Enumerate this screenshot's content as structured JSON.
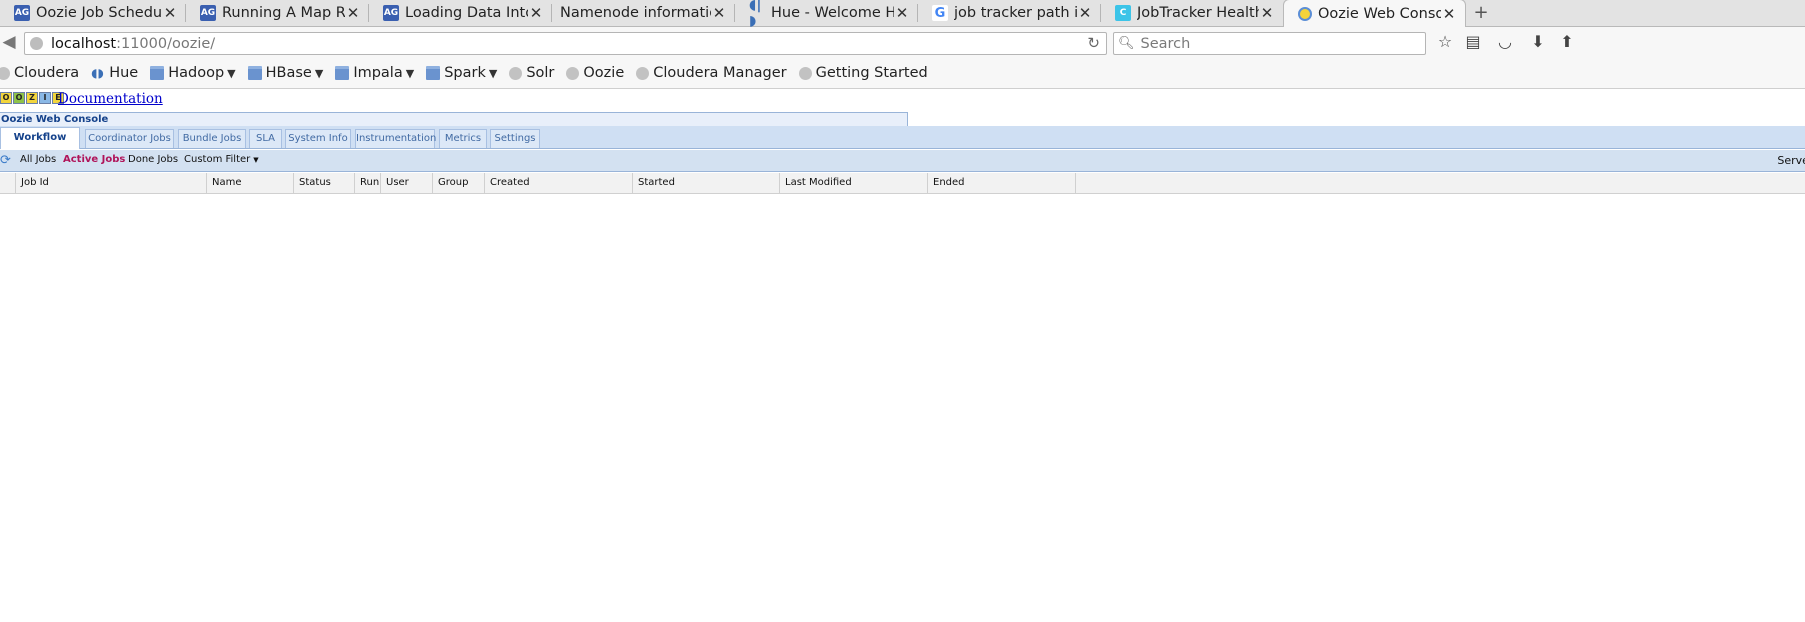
{
  "browser": {
    "tabs": [
      {
        "title": "Oozie Job Scheduling...",
        "icon": "ag-icon",
        "active": false
      },
      {
        "title": "Running A Map Redu...",
        "icon": "ag-icon",
        "active": false
      },
      {
        "title": "Loading Data Into HB...",
        "icon": "ag-icon",
        "active": false
      },
      {
        "title": "Namenode information",
        "icon": "none",
        "active": false
      },
      {
        "title": "Hue - Welcome Home",
        "icon": "hue-icon",
        "active": false
      },
      {
        "title": "job tracker path in cl...",
        "icon": "google-icon",
        "active": false
      },
      {
        "title": "JobTracker Health Tests",
        "icon": "cloudera-c-icon",
        "active": false
      },
      {
        "title": "Oozie Web Console",
        "icon": "oozie-icon",
        "active": true
      }
    ],
    "url_host": "localhost",
    "url_path": ":11000/oozie/",
    "search_placeholder": "Search",
    "bookmarks": [
      {
        "label": "Cloudera",
        "icon": "globe-icon",
        "dropdown": false
      },
      {
        "label": "Hue",
        "icon": "hue-icon",
        "dropdown": false
      },
      {
        "label": "Hadoop",
        "icon": "folder-icon",
        "dropdown": true
      },
      {
        "label": "HBase",
        "icon": "folder-icon",
        "dropdown": true
      },
      {
        "label": "Impala",
        "icon": "folder-icon",
        "dropdown": true
      },
      {
        "label": "Spark",
        "icon": "folder-icon",
        "dropdown": true
      },
      {
        "label": "Solr",
        "icon": "globe-icon",
        "dropdown": false
      },
      {
        "label": "Oozie",
        "icon": "globe-icon",
        "dropdown": false
      },
      {
        "label": "Cloudera Manager",
        "icon": "globe-icon",
        "dropdown": false
      },
      {
        "label": "Getting Started",
        "icon": "globe-icon",
        "dropdown": false
      }
    ]
  },
  "oozie": {
    "logo_letters": [
      "O",
      "O",
      "Z",
      "I",
      "E"
    ],
    "documentation_link": "Documentation",
    "console_title": "Oozie Web Console",
    "tabs": [
      "Workflow Jobs",
      "Coordinator Jobs",
      "Bundle Jobs",
      "SLA",
      "System Info",
      "Instrumentation",
      "Metrics",
      "Settings"
    ],
    "active_tab": "Workflow Jobs",
    "filters": [
      "All Jobs",
      "Active Jobs",
      "Done Jobs",
      "Custom Filter"
    ],
    "active_filter": "Active Jobs",
    "server_version_label": "Server version [",
    "columns": [
      "",
      "Job Id",
      "Name",
      "Status",
      "Run",
      "User",
      "Group",
      "Created",
      "Started",
      "Last Modified",
      "Ended"
    ],
    "rows": []
  },
  "colors": {
    "link": "#0000cc",
    "active_filter": "#b0145a",
    "ext_tab_text": "#15428b"
  }
}
